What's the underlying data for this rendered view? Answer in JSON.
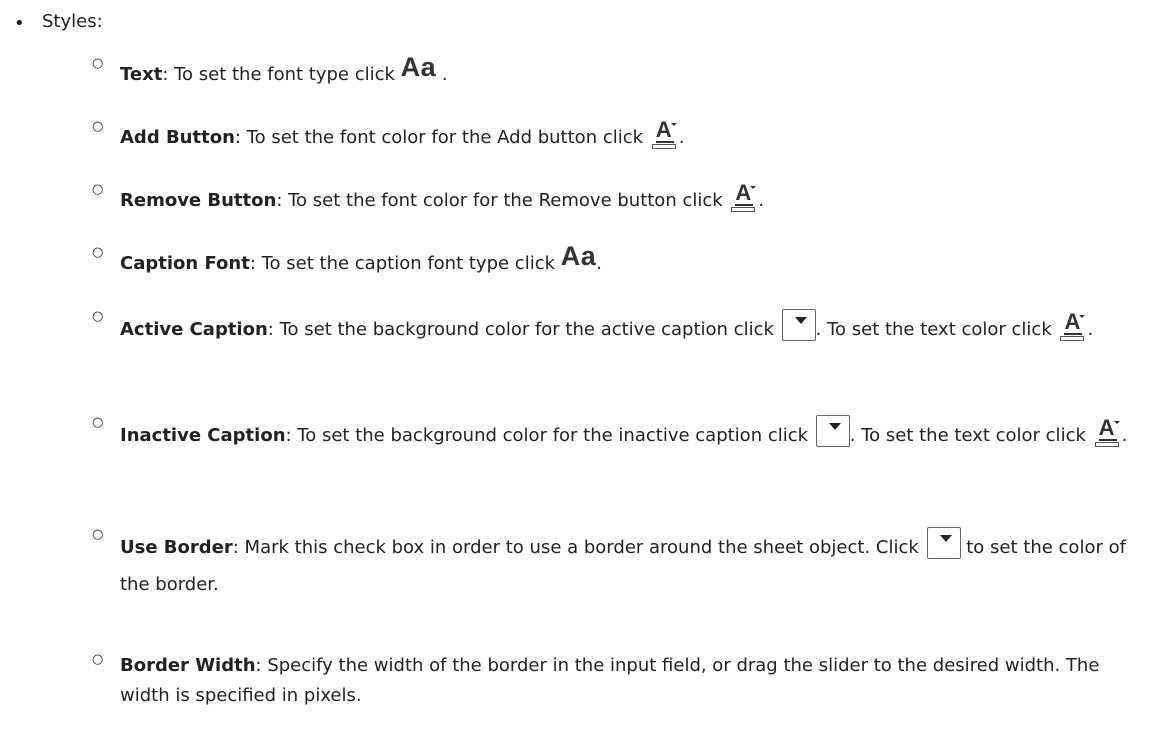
{
  "styles_heading": "Styles:",
  "items": {
    "text": {
      "term": "Text",
      "desc": ": To set the font type click ",
      "end": " ."
    },
    "add_button": {
      "term": "Add Button",
      "desc": ": To set the font color for the Add button click ",
      "end": "."
    },
    "remove_button": {
      "term": "Remove Button",
      "desc": ": To set the font color for the Remove button click ",
      "end": "."
    },
    "caption_font": {
      "term": "Caption Font",
      "desc": ": To set the caption font type click ",
      "end": "."
    },
    "active_caption": {
      "term": "Active Caption",
      "desc1": ": To set the background color for the active caption click ",
      "desc2": ". To set the text color click ",
      "end": "."
    },
    "inactive_caption": {
      "term": "Inactive Caption",
      "desc1": ": To set the background color for the inactive caption click ",
      "desc2": ". To set the text color click ",
      "end": "."
    },
    "use_border": {
      "term": "Use Border",
      "desc1": ": Mark this check box in order to use a border around the sheet object. Click ",
      "desc2": " to set the color of the border."
    },
    "border_width": {
      "term": "Border Width",
      "desc": ": Specify the width of the border in the input field, or drag the slider to the desired width. The width is specified in pixels."
    }
  },
  "icons": {
    "font_type": "Aa",
    "font_color_letter": "A",
    "font_type_icon": "font-type-icon",
    "font_color_icon": "font-color-icon",
    "color_picker_icon": "color-picker-icon"
  }
}
